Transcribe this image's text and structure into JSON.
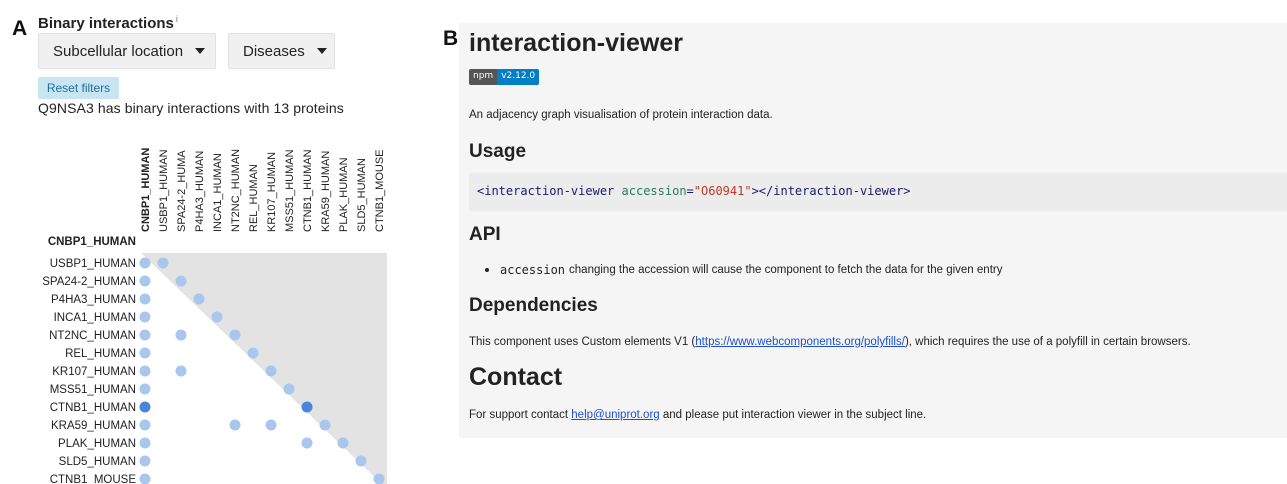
{
  "panel_a": {
    "letter": "A",
    "title": "Binary interactions",
    "title_sup": "i",
    "filters": {
      "subcellular_label": "Subcellular location",
      "diseases_label": "Diseases",
      "reset_label": "Reset filters"
    },
    "summary": "Q9NSA3 has binary interactions with 13 proteins",
    "proteins": [
      "CNBP1_HUMAN",
      "USBP1_HUMAN",
      "SPA24-2_HUMAN",
      "P4HA3_HUMAN",
      "INCA1_HUMAN",
      "NT2NC_HUMAN",
      "REL_HUMAN",
      "KR107_HUMAN",
      "MSS51_HUMAN",
      "CTNB1_HUMAN",
      "KRA59_HUMAN",
      "PLAK_HUMAN",
      "SLD5_HUMAN",
      "CTNB1_MOUSE"
    ],
    "column_labels_display": [
      "CNBP1_HUMAN",
      "USBP1_HUMAN",
      "SPA24-2_HUMA",
      "P4HA3_HUMAN",
      "INCA1_HUMAN",
      "NT2NC_HUMAN",
      "REL_HUMAN",
      "KR107_HUMAN",
      "MSS51_HUMAN",
      "CTNB1_HUMAN",
      "KRA59_HUMAN",
      "PLAK_HUMAN",
      "SLD5_HUMAN",
      "CTNB1_MOUSE"
    ],
    "interactions": [
      {
        "row": 1,
        "col": 0
      },
      {
        "row": 1,
        "col": 1
      },
      {
        "row": 2,
        "col": 0
      },
      {
        "row": 2,
        "col": 2
      },
      {
        "row": 3,
        "col": 0
      },
      {
        "row": 3,
        "col": 3
      },
      {
        "row": 4,
        "col": 0
      },
      {
        "row": 4,
        "col": 4
      },
      {
        "row": 5,
        "col": 0
      },
      {
        "row": 5,
        "col": 2
      },
      {
        "row": 5,
        "col": 5
      },
      {
        "row": 6,
        "col": 0
      },
      {
        "row": 6,
        "col": 6
      },
      {
        "row": 7,
        "col": 0
      },
      {
        "row": 7,
        "col": 2
      },
      {
        "row": 7,
        "col": 7
      },
      {
        "row": 8,
        "col": 0
      },
      {
        "row": 8,
        "col": 8
      },
      {
        "row": 9,
        "col": 0,
        "strong": true
      },
      {
        "row": 9,
        "col": 9,
        "strong": true
      },
      {
        "row": 10,
        "col": 0
      },
      {
        "row": 10,
        "col": 5
      },
      {
        "row": 10,
        "col": 7
      },
      {
        "row": 10,
        "col": 10
      },
      {
        "row": 11,
        "col": 0
      },
      {
        "row": 11,
        "col": 9
      },
      {
        "row": 11,
        "col": 11
      },
      {
        "row": 12,
        "col": 0
      },
      {
        "row": 12,
        "col": 12
      },
      {
        "row": 13,
        "col": 0
      },
      {
        "row": 13,
        "col": 13
      }
    ],
    "colors": {
      "dot": "#a9c6ec",
      "dot_strong": "#4a86d8",
      "triangle": "#e3e3e3"
    }
  },
  "panel_b": {
    "letter": "B",
    "title": "interaction-viewer",
    "npm_label": "npm",
    "npm_version": "v2.12.0",
    "description": "An adjacency graph visualisation of protein interaction data.",
    "usage_heading": "Usage",
    "code": {
      "open_tag": "<interaction-viewer",
      "attr": "accession",
      "eq": "=",
      "value": "\"O60941\"",
      "close": "></interaction-viewer>"
    },
    "api_heading": "API",
    "api_item_code": "accession",
    "api_item_text": "changing the accession will cause the component to fetch the data for the given entry",
    "deps_heading": "Dependencies",
    "deps_prefix": "This component uses Custom elements V1 (",
    "deps_link": "https://www.webcomponents.org/polyfills/",
    "deps_suffix": "), which requires the use of a polyfill in certain browsers.",
    "contact_heading": "Contact",
    "contact_prefix": "For support contact ",
    "contact_email": "help@uniprot.org",
    "contact_suffix": " and please put interaction viewer in the subject line."
  }
}
